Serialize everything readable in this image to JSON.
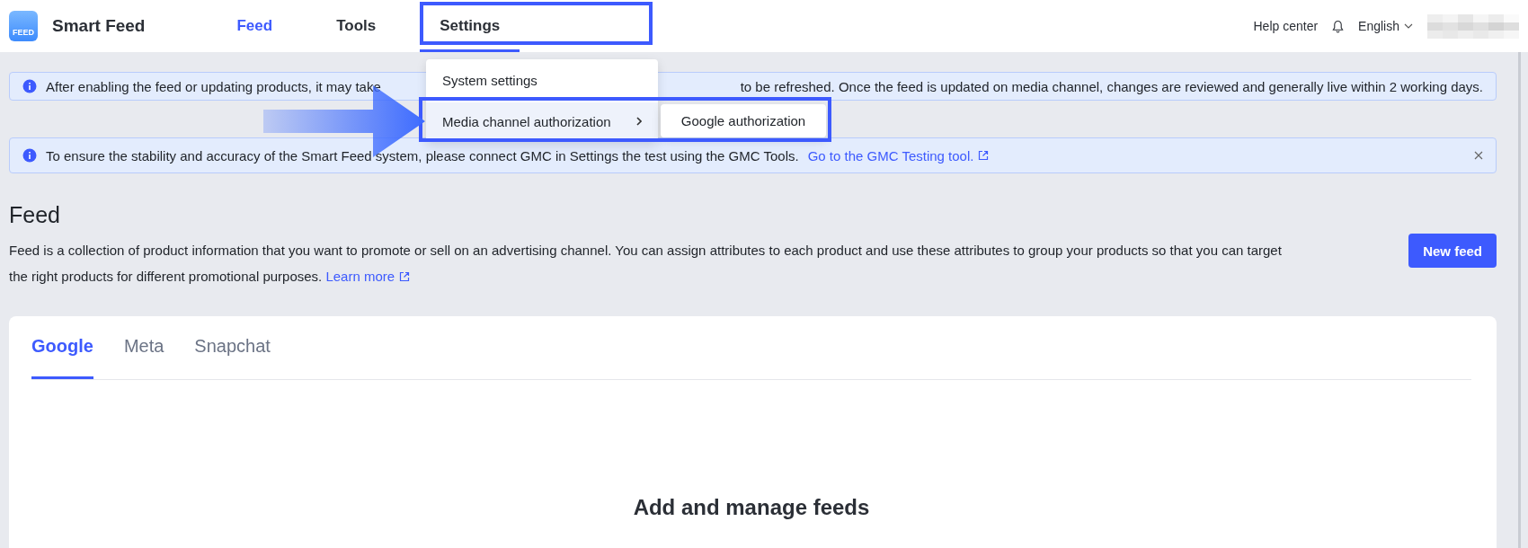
{
  "app": {
    "name": "Smart Feed",
    "logo_text": "FEED"
  },
  "nav": [
    {
      "label": "Feed",
      "selected": true,
      "open": false
    },
    {
      "label": "Tools",
      "selected": false,
      "open": false
    },
    {
      "label": "Settings",
      "selected": false,
      "open": true
    }
  ],
  "header_right": {
    "help": "Help center",
    "language": "English"
  },
  "dropdown": {
    "items": [
      {
        "label": "System settings",
        "has_submenu": false,
        "highlighted": false
      },
      {
        "label": "Media channel authorization",
        "has_submenu": true,
        "highlighted": true
      }
    ],
    "submenu": [
      "Google authorization"
    ]
  },
  "banners": [
    {
      "kind": "info",
      "segments": [
        "After enabling the feed or updating products, it may take",
        "to be refreshed. Once the feed is updated on media channel, changes are reviewed and generally live within 2 working days."
      ],
      "closable": false
    },
    {
      "kind": "info",
      "segments": [
        "To ensure the stability and accuracy of the Smart Feed system, please connect GMC in Settings the test using the GMC Tools."
      ],
      "link": "Go to the GMC Testing tool.",
      "closable": true
    }
  ],
  "page": {
    "title": "Feed",
    "description": "Feed is a collection of product information that you want to promote or sell on an advertising channel. You can assign attributes to each product and use these attributes to group your products so that you can target the right products for different promotional purposes.",
    "learn_more": "Learn more",
    "new_button": "New feed"
  },
  "tabs": [
    {
      "label": "Google",
      "selected": true
    },
    {
      "label": "Meta",
      "selected": false
    },
    {
      "label": "Snapchat",
      "selected": false
    }
  ],
  "empty_state": {
    "title": "Add and manage feeds"
  }
}
